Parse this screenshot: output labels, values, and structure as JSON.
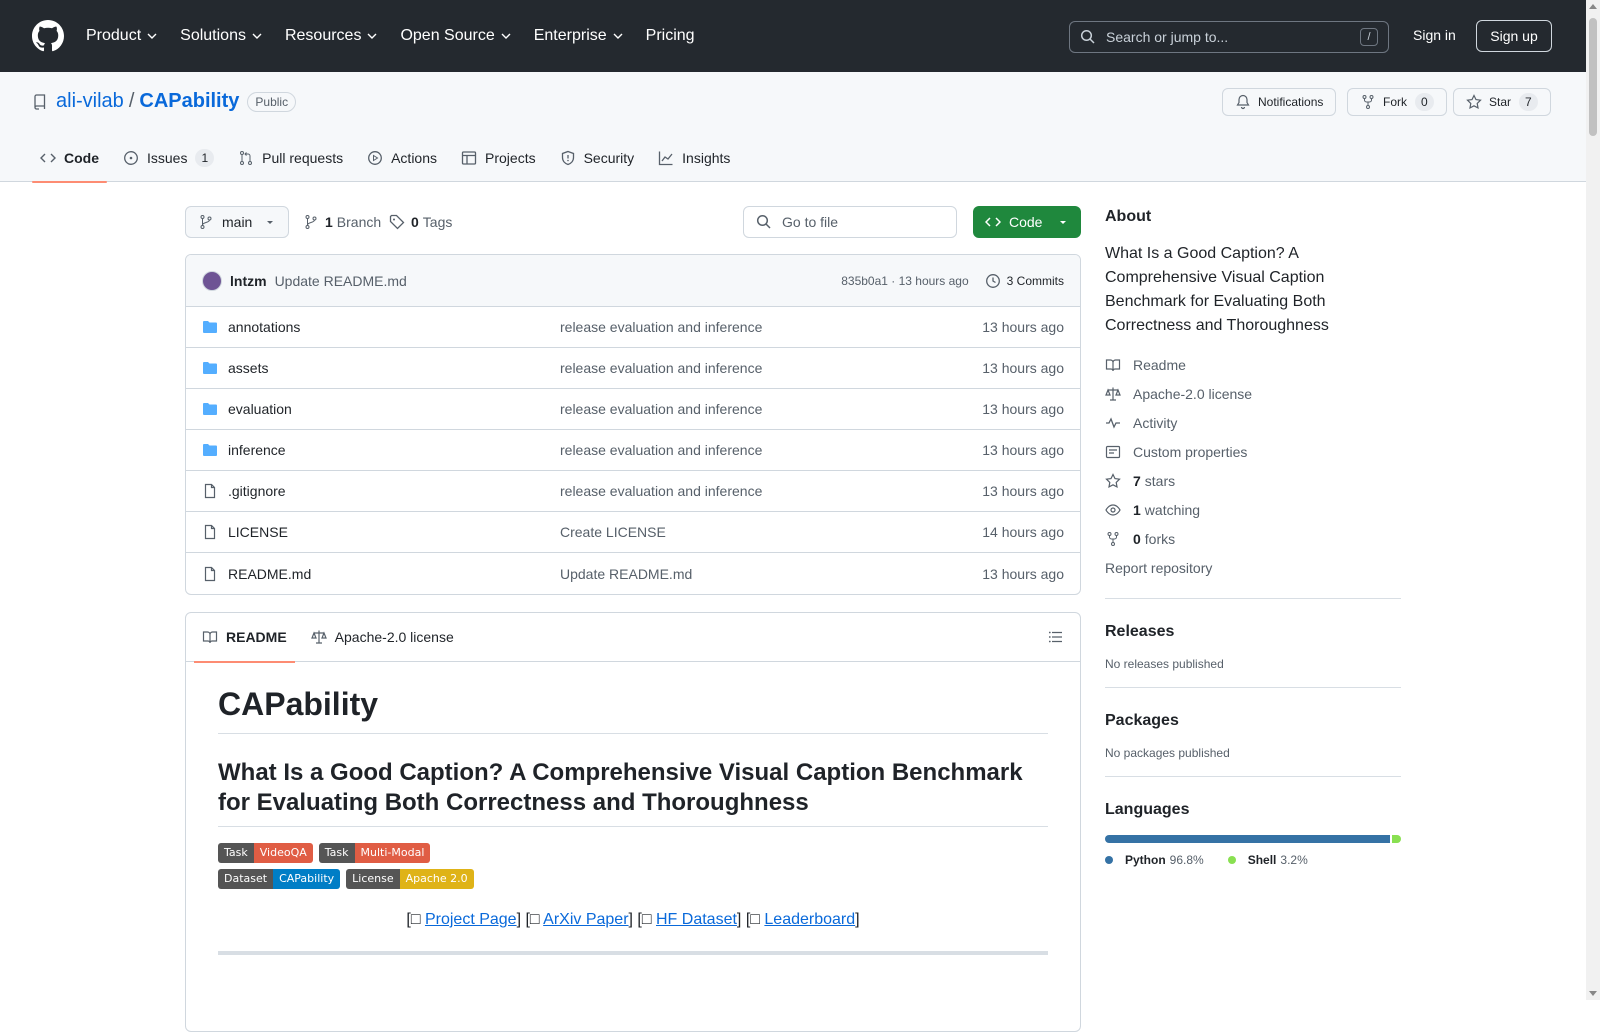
{
  "topbar": {
    "nav": [
      "Product",
      "Solutions",
      "Resources",
      "Open Source",
      "Enterprise",
      "Pricing"
    ],
    "search_placeholder": "Search or jump to...",
    "search_shortcut": "/",
    "signin": "Sign in",
    "signup": "Sign up"
  },
  "repo": {
    "owner": "ali-vilab",
    "name": "CAPability",
    "visibility": "Public",
    "notifications": "Notifications",
    "fork": "Fork",
    "fork_count": "0",
    "star": "Star",
    "star_count": "7"
  },
  "tabs": [
    {
      "label": "Code",
      "icon": "code-icon"
    },
    {
      "label": "Issues",
      "count": "1",
      "icon": "issue-icon"
    },
    {
      "label": "Pull requests",
      "icon": "pull-request-icon"
    },
    {
      "label": "Actions",
      "icon": "play-icon"
    },
    {
      "label": "Projects",
      "icon": "table-icon"
    },
    {
      "label": "Security",
      "icon": "shield-icon"
    },
    {
      "label": "Insights",
      "icon": "graph-icon"
    }
  ],
  "toolbar": {
    "branch": "main",
    "branch_count": "1",
    "branch_label": "Branch",
    "tag_count": "0",
    "tag_label": "Tags",
    "goto_placeholder": "Go to file",
    "code_button": "Code"
  },
  "commit": {
    "author": "lntzm",
    "message": "Update README.md",
    "meta": "835b0a1 · 13 hours ago",
    "commits": "3 Commits"
  },
  "files": [
    {
      "name": "annotations",
      "type": "dir",
      "message": "release evaluation and inference",
      "time": "13 hours ago"
    },
    {
      "name": "assets",
      "type": "dir",
      "message": "release evaluation and inference",
      "time": "13 hours ago"
    },
    {
      "name": "evaluation",
      "type": "dir",
      "message": "release evaluation and inference",
      "time": "13 hours ago"
    },
    {
      "name": "inference",
      "type": "dir",
      "message": "release evaluation and inference",
      "time": "13 hours ago"
    },
    {
      "name": ".gitignore",
      "type": "file",
      "message": "release evaluation and inference",
      "time": "13 hours ago"
    },
    {
      "name": "LICENSE",
      "type": "file",
      "message": "Create LICENSE",
      "time": "14 hours ago"
    },
    {
      "name": "README.md",
      "type": "file",
      "message": "Update README.md",
      "time": "13 hours ago"
    }
  ],
  "readme": {
    "tab_readme": "README",
    "tab_license": "Apache-2.0 license",
    "h1": "CAPability",
    "h2": "What Is a Good Caption? A Comprehensive Visual Caption Benchmark for Evaluating Both Correctness and Thoroughness",
    "badges": [
      {
        "left": "Task",
        "right": "VideoQA",
        "color": "#e05d44"
      },
      {
        "left": "Task",
        "right": "Multi-Modal",
        "color": "#e05d44"
      },
      {
        "left": "Dataset",
        "right": "CAPability",
        "color": "#007ec6"
      },
      {
        "left": "License",
        "right": "Apache 2.0",
        "color": "#dfb317"
      }
    ],
    "links": [
      "Project Page",
      "ArXiv Paper",
      "HF Dataset",
      "Leaderboard"
    ]
  },
  "about": {
    "title": "About",
    "description": "What Is a Good Caption? A Comprehensive Visual Caption Benchmark for Evaluating Both Correctness and Thoroughness",
    "items": [
      {
        "icon": "book-icon",
        "label": "Readme"
      },
      {
        "icon": "law-icon",
        "label": "Apache-2.0 license"
      },
      {
        "icon": "pulse-icon",
        "label": "Activity"
      },
      {
        "icon": "note-icon",
        "label": "Custom properties"
      },
      {
        "icon": "star-icon",
        "strong": "7",
        "label": "stars"
      },
      {
        "icon": "eye-icon",
        "strong": "1",
        "label": "watching"
      },
      {
        "icon": "fork-icon",
        "strong": "0",
        "label": "forks"
      }
    ],
    "report": "Report repository"
  },
  "releases": {
    "title": "Releases",
    "text": "No releases published"
  },
  "packages": {
    "title": "Packages",
    "text": "No packages published"
  },
  "languages": {
    "title": "Languages",
    "items": [
      {
        "name": "Python",
        "percent": "96.8%",
        "value": 96.8,
        "color": "#3572A5"
      },
      {
        "name": "Shell",
        "percent": "3.2%",
        "value": 3.2,
        "color": "#89e051"
      }
    ]
  }
}
